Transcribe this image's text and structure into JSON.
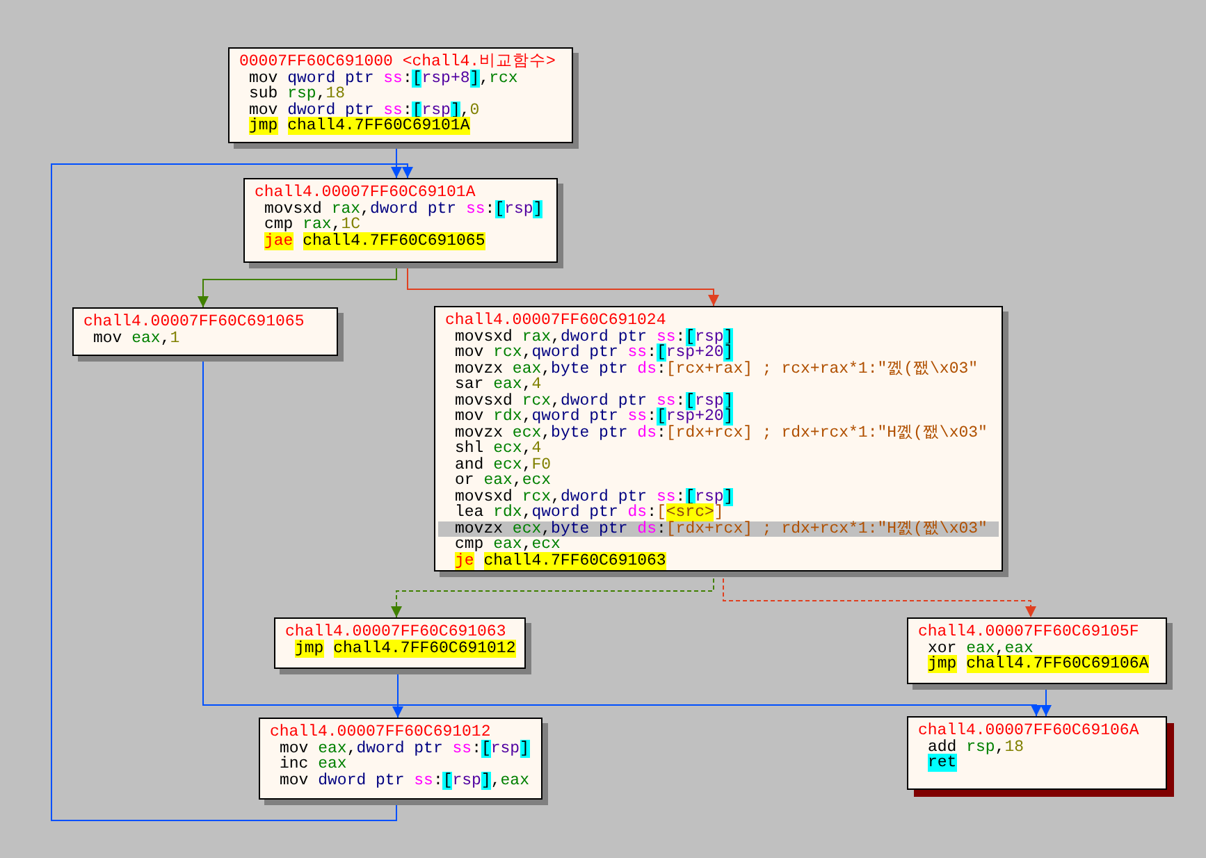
{
  "nodes": [
    {
      "header": "00007FF60C691000 <chall4.비교함수>",
      "current": false,
      "lines": [
        {
          "selected": false,
          "tokens": [
            {
              "text": "mov ",
              "kind": "mn"
            },
            {
              "text": "qword ptr ",
              "kind": "size"
            },
            {
              "text": "ss",
              "kind": "seg"
            },
            {
              "text": ":",
              "kind": "mn"
            },
            {
              "text": "[",
              "kind": "cbr"
            },
            {
              "text": "rsp+8",
              "kind": "memreg"
            },
            {
              "text": "]",
              "kind": "cbr"
            },
            {
              "text": ",",
              "kind": "mn"
            },
            {
              "text": "rcx",
              "kind": "reg"
            }
          ]
        },
        {
          "selected": false,
          "tokens": [
            {
              "text": "sub ",
              "kind": "mn"
            },
            {
              "text": "rsp",
              "kind": "reg"
            },
            {
              "text": ",",
              "kind": "mn"
            },
            {
              "text": "18",
              "kind": "num"
            }
          ]
        },
        {
          "selected": false,
          "tokens": [
            {
              "text": "mov ",
              "kind": "mn"
            },
            {
              "text": "dword ptr ",
              "kind": "size"
            },
            {
              "text": "ss",
              "kind": "seg"
            },
            {
              "text": ":",
              "kind": "mn"
            },
            {
              "text": "[",
              "kind": "cbr"
            },
            {
              "text": "rsp",
              "kind": "memreg"
            },
            {
              "text": "]",
              "kind": "cbr"
            },
            {
              "text": ",",
              "kind": "mn"
            },
            {
              "text": "0",
              "kind": "num"
            }
          ]
        },
        {
          "selected": false,
          "tokens": [
            {
              "text": "jmp",
              "kind": "jmp"
            },
            {
              "text": "chall4.7FF60C69101A",
              "kind": "label"
            }
          ]
        }
      ]
    },
    {
      "header": "chall4.00007FF60C69101A",
      "current": false,
      "lines": [
        {
          "selected": false,
          "tokens": [
            {
              "text": "movsxd ",
              "kind": "mn"
            },
            {
              "text": "rax",
              "kind": "reg"
            },
            {
              "text": ",",
              "kind": "mn"
            },
            {
              "text": "dword ptr ",
              "kind": "size"
            },
            {
              "text": "ss",
              "kind": "seg"
            },
            {
              "text": ":",
              "kind": "mn"
            },
            {
              "text": "[",
              "kind": "cbr"
            },
            {
              "text": "rsp",
              "kind": "memreg"
            },
            {
              "text": "]",
              "kind": "cbr"
            }
          ]
        },
        {
          "selected": false,
          "tokens": [
            {
              "text": "cmp ",
              "kind": "mn"
            },
            {
              "text": "rax",
              "kind": "reg"
            },
            {
              "text": ",",
              "kind": "mn"
            },
            {
              "text": "1C",
              "kind": "num"
            }
          ]
        },
        {
          "selected": false,
          "tokens": [
            {
              "text": "jae",
              "kind": "jcc"
            },
            {
              "text": "chall4.7FF60C691065",
              "kind": "label"
            }
          ]
        }
      ]
    },
    {
      "header": "chall4.00007FF60C691065",
      "current": false,
      "lines": [
        {
          "selected": false,
          "tokens": [
            {
              "text": "mov ",
              "kind": "mn"
            },
            {
              "text": "eax",
              "kind": "reg"
            },
            {
              "text": ",",
              "kind": "mn"
            },
            {
              "text": "1",
              "kind": "num"
            }
          ]
        }
      ]
    },
    {
      "header": "chall4.00007FF60C691024",
      "current": false,
      "lines": [
        {
          "selected": false,
          "tokens": [
            {
              "text": "movsxd ",
              "kind": "mn"
            },
            {
              "text": "rax",
              "kind": "reg"
            },
            {
              "text": ",",
              "kind": "mn"
            },
            {
              "text": "dword ptr ",
              "kind": "size"
            },
            {
              "text": "ss",
              "kind": "seg"
            },
            {
              "text": ":",
              "kind": "mn"
            },
            {
              "text": "[",
              "kind": "cbr"
            },
            {
              "text": "rsp",
              "kind": "memreg"
            },
            {
              "text": "]",
              "kind": "cbr"
            }
          ]
        },
        {
          "selected": false,
          "tokens": [
            {
              "text": "mov ",
              "kind": "mn"
            },
            {
              "text": "rcx",
              "kind": "reg"
            },
            {
              "text": ",",
              "kind": "mn"
            },
            {
              "text": "qword ptr ",
              "kind": "size"
            },
            {
              "text": "ss",
              "kind": "seg"
            },
            {
              "text": ":",
              "kind": "mn"
            },
            {
              "text": "[",
              "kind": "cbr"
            },
            {
              "text": "rsp+20",
              "kind": "memreg"
            },
            {
              "text": "]",
              "kind": "cbr"
            }
          ]
        },
        {
          "selected": false,
          "tokens": [
            {
              "text": "movzx ",
              "kind": "mn"
            },
            {
              "text": "eax",
              "kind": "reg"
            },
            {
              "text": ",",
              "kind": "mn"
            },
            {
              "text": "byte ptr ",
              "kind": "size"
            },
            {
              "text": "ds",
              "kind": "seg"
            },
            {
              "text": ":",
              "kind": "mn"
            },
            {
              "text": "[rcx+rax]",
              "kind": "mem"
            },
            {
              "text": " ; rcx+rax*1:\"꼜(쨊\\x03\"",
              "kind": "comment"
            }
          ]
        },
        {
          "selected": false,
          "tokens": [
            {
              "text": "sar ",
              "kind": "mn"
            },
            {
              "text": "eax",
              "kind": "reg"
            },
            {
              "text": ",",
              "kind": "mn"
            },
            {
              "text": "4",
              "kind": "num"
            }
          ]
        },
        {
          "selected": false,
          "tokens": [
            {
              "text": "movsxd ",
              "kind": "mn"
            },
            {
              "text": "rcx",
              "kind": "reg"
            },
            {
              "text": ",",
              "kind": "mn"
            },
            {
              "text": "dword ptr ",
              "kind": "size"
            },
            {
              "text": "ss",
              "kind": "seg"
            },
            {
              "text": ":",
              "kind": "mn"
            },
            {
              "text": "[",
              "kind": "cbr"
            },
            {
              "text": "rsp",
              "kind": "memreg"
            },
            {
              "text": "]",
              "kind": "cbr"
            }
          ]
        },
        {
          "selected": false,
          "tokens": [
            {
              "text": "mov ",
              "kind": "mn"
            },
            {
              "text": "rdx",
              "kind": "reg"
            },
            {
              "text": ",",
              "kind": "mn"
            },
            {
              "text": "qword ptr ",
              "kind": "size"
            },
            {
              "text": "ss",
              "kind": "seg"
            },
            {
              "text": ":",
              "kind": "mn"
            },
            {
              "text": "[",
              "kind": "cbr"
            },
            {
              "text": "rsp+20",
              "kind": "memreg"
            },
            {
              "text": "]",
              "kind": "cbr"
            }
          ]
        },
        {
          "selected": false,
          "tokens": [
            {
              "text": "movzx ",
              "kind": "mn"
            },
            {
              "text": "ecx",
              "kind": "reg"
            },
            {
              "text": ",",
              "kind": "mn"
            },
            {
              "text": "byte ptr ",
              "kind": "size"
            },
            {
              "text": "ds",
              "kind": "seg"
            },
            {
              "text": ":",
              "kind": "mn"
            },
            {
              "text": "[rdx+rcx]",
              "kind": "mem"
            },
            {
              "text": " ; rdx+rcx*1:\"H꼜(쨊\\x03\"",
              "kind": "comment"
            }
          ]
        },
        {
          "selected": false,
          "tokens": [
            {
              "text": "shl ",
              "kind": "mn"
            },
            {
              "text": "ecx",
              "kind": "reg"
            },
            {
              "text": ",",
              "kind": "mn"
            },
            {
              "text": "4",
              "kind": "num"
            }
          ]
        },
        {
          "selected": false,
          "tokens": [
            {
              "text": "and ",
              "kind": "mn"
            },
            {
              "text": "ecx",
              "kind": "reg"
            },
            {
              "text": ",",
              "kind": "mn"
            },
            {
              "text": "F0",
              "kind": "num"
            }
          ]
        },
        {
          "selected": false,
          "tokens": [
            {
              "text": "or ",
              "kind": "mn"
            },
            {
              "text": "eax",
              "kind": "reg"
            },
            {
              "text": ",",
              "kind": "mn"
            },
            {
              "text": "ecx",
              "kind": "reg"
            }
          ]
        },
        {
          "selected": false,
          "tokens": [
            {
              "text": "movsxd ",
              "kind": "mn"
            },
            {
              "text": "rcx",
              "kind": "reg"
            },
            {
              "text": ",",
              "kind": "mn"
            },
            {
              "text": "dword ptr ",
              "kind": "size"
            },
            {
              "text": "ss",
              "kind": "seg"
            },
            {
              "text": ":",
              "kind": "mn"
            },
            {
              "text": "[",
              "kind": "cbr"
            },
            {
              "text": "rsp",
              "kind": "memreg"
            },
            {
              "text": "]",
              "kind": "cbr"
            }
          ]
        },
        {
          "selected": false,
          "tokens": [
            {
              "text": "lea ",
              "kind": "mn"
            },
            {
              "text": "rdx",
              "kind": "reg"
            },
            {
              "text": ",",
              "kind": "mn"
            },
            {
              "text": "qword ptr ",
              "kind": "size"
            },
            {
              "text": "ds",
              "kind": "seg"
            },
            {
              "text": ":",
              "kind": "mn"
            },
            {
              "text": "[",
              "kind": "mem"
            },
            {
              "text": "<src>",
              "kind": "sym"
            },
            {
              "text": "]",
              "kind": "mem"
            }
          ]
        },
        {
          "selected": true,
          "tokens": [
            {
              "text": "movzx ",
              "kind": "mn"
            },
            {
              "text": "ecx",
              "kind": "reg"
            },
            {
              "text": ",",
              "kind": "mn"
            },
            {
              "text": "byte ptr ",
              "kind": "size"
            },
            {
              "text": "ds",
              "kind": "seg"
            },
            {
              "text": ":",
              "kind": "mn"
            },
            {
              "text": "[rdx+rcx]",
              "kind": "mem"
            },
            {
              "text": " ; rdx+rcx*1:\"H꼜(쨊\\x03\"",
              "kind": "comment"
            }
          ]
        },
        {
          "selected": false,
          "tokens": [
            {
              "text": "cmp ",
              "kind": "mn"
            },
            {
              "text": "eax",
              "kind": "reg"
            },
            {
              "text": ",",
              "kind": "mn"
            },
            {
              "text": "ecx",
              "kind": "reg"
            }
          ]
        },
        {
          "selected": false,
          "tokens": [
            {
              "text": "je",
              "kind": "jcc"
            },
            {
              "text": "chall4.7FF60C691063",
              "kind": "label"
            }
          ]
        }
      ]
    },
    {
      "header": "chall4.00007FF60C691063",
      "current": false,
      "lines": [
        {
          "selected": false,
          "tokens": [
            {
              "text": "jmp",
              "kind": "jmp"
            },
            {
              "text": "chall4.7FF60C691012",
              "kind": "label"
            }
          ]
        }
      ]
    },
    {
      "header": "chall4.00007FF60C691012",
      "current": false,
      "lines": [
        {
          "selected": false,
          "tokens": [
            {
              "text": "mov ",
              "kind": "mn"
            },
            {
              "text": "eax",
              "kind": "reg"
            },
            {
              "text": ",",
              "kind": "mn"
            },
            {
              "text": "dword ptr ",
              "kind": "size"
            },
            {
              "text": "ss",
              "kind": "seg"
            },
            {
              "text": ":",
              "kind": "mn"
            },
            {
              "text": "[",
              "kind": "cbr"
            },
            {
              "text": "rsp",
              "kind": "memreg"
            },
            {
              "text": "]",
              "kind": "cbr"
            }
          ]
        },
        {
          "selected": false,
          "tokens": [
            {
              "text": "inc ",
              "kind": "mn"
            },
            {
              "text": "eax",
              "kind": "reg"
            }
          ]
        },
        {
          "selected": false,
          "tokens": [
            {
              "text": "mov ",
              "kind": "mn"
            },
            {
              "text": "dword ptr ",
              "kind": "size"
            },
            {
              "text": "ss",
              "kind": "seg"
            },
            {
              "text": ":",
              "kind": "mn"
            },
            {
              "text": "[",
              "kind": "cbr"
            },
            {
              "text": "rsp",
              "kind": "memreg"
            },
            {
              "text": "]",
              "kind": "cbr"
            },
            {
              "text": ",",
              "kind": "mn"
            },
            {
              "text": "eax",
              "kind": "reg"
            }
          ]
        }
      ]
    },
    {
      "header": "chall4.00007FF60C69105F",
      "current": false,
      "lines": [
        {
          "selected": false,
          "tokens": [
            {
              "text": "xor ",
              "kind": "mn"
            },
            {
              "text": "eax",
              "kind": "reg"
            },
            {
              "text": ",",
              "kind": "mn"
            },
            {
              "text": "eax",
              "kind": "reg"
            }
          ]
        },
        {
          "selected": false,
          "tokens": [
            {
              "text": "jmp",
              "kind": "jmp"
            },
            {
              "text": "chall4.7FF60C69106A",
              "kind": "label"
            }
          ]
        }
      ]
    },
    {
      "header": "chall4.00007FF60C69106A",
      "current": true,
      "lines": [
        {
          "selected": false,
          "tokens": [
            {
              "text": "add ",
              "kind": "mn"
            },
            {
              "text": "rsp",
              "kind": "reg"
            },
            {
              "text": ",",
              "kind": "mn"
            },
            {
              "text": "18",
              "kind": "num"
            }
          ]
        },
        {
          "selected": false,
          "tokens": [
            {
              "text": "ret",
              "kind": "ret"
            }
          ]
        }
      ]
    }
  ],
  "edges": [
    {
      "color": "#0050ff",
      "dashed": false
    },
    {
      "color": "#0050ff",
      "dashed": false
    },
    {
      "color": "#408000",
      "dashed": false
    },
    {
      "color": "#e04020",
      "dashed": false
    },
    {
      "color": "#0050ff",
      "dashed": false
    },
    {
      "color": "#408000",
      "dashed": true
    },
    {
      "color": "#e04020",
      "dashed": true
    },
    {
      "color": "#0050ff",
      "dashed": false
    },
    {
      "color": "#0050ff",
      "dashed": false
    }
  ]
}
